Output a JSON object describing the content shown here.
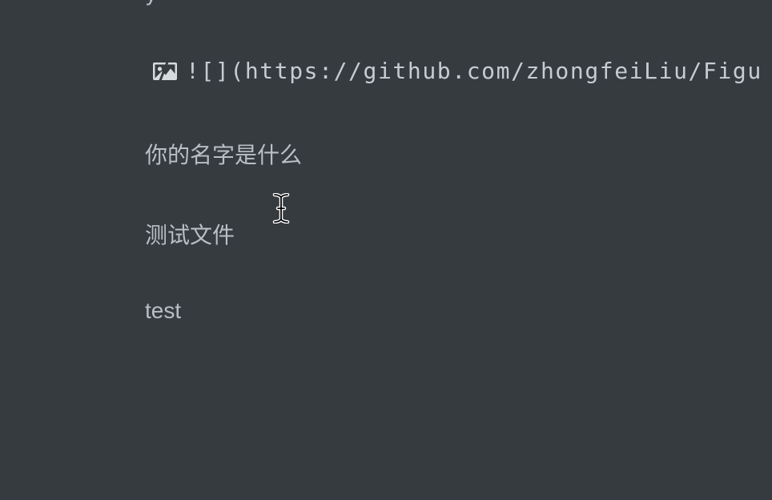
{
  "editor": {
    "clipped_top_line": "y",
    "image_markdown": "![](https://github.com/zhongfeiLiu/Figu",
    "lines": [
      "你的名字是什么",
      "测试文件",
      "test"
    ]
  },
  "icons": {
    "broken_image": "broken-image-icon",
    "cursor": "ibeam-cursor-icon"
  },
  "colors": {
    "background": "#363b40",
    "text": "#b8bfc6"
  }
}
